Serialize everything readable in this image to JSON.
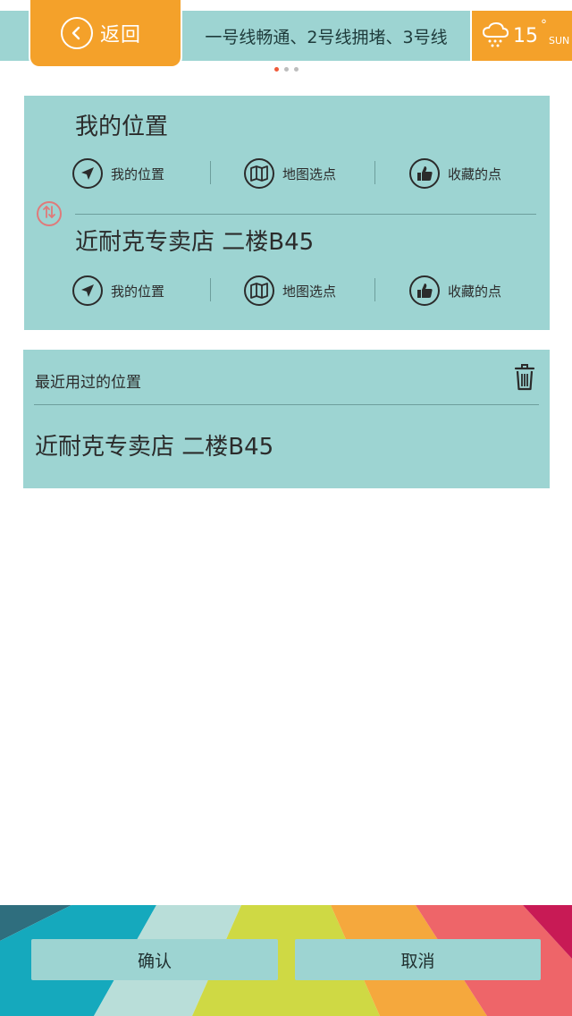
{
  "topbar": {
    "back_label": "返回",
    "traffic_text": "一号线畅通、2号线拥堵、3号线",
    "weather": {
      "temperature": "15",
      "degree": "°",
      "day": "SUN",
      "icon": "cloud-snow-icon"
    },
    "carousel": {
      "count": 3,
      "active_index": 0
    }
  },
  "route": {
    "origin": {
      "name": "我的位置"
    },
    "destination": {
      "name": "近耐克专卖店  二楼B45"
    },
    "options": [
      {
        "label": "我的位置",
        "icon": "navigation-arrow-icon"
      },
      {
        "label": "地图选点",
        "icon": "map-icon"
      },
      {
        "label": "收藏的点",
        "icon": "thumbs-up-icon"
      }
    ],
    "swap_icon": "swap-icon"
  },
  "recent": {
    "title": "最近用过的位置",
    "delete_icon": "trash-icon",
    "items": [
      {
        "name": "近耐克专卖店  二楼B45"
      }
    ]
  },
  "footer": {
    "confirm_label": "确认",
    "cancel_label": "取消"
  },
  "colors": {
    "accent_orange": "#f4a12a",
    "panel_teal": "#9dd4d2",
    "swap_red": "#e07a7a",
    "dot_active": "#f05a3a"
  }
}
